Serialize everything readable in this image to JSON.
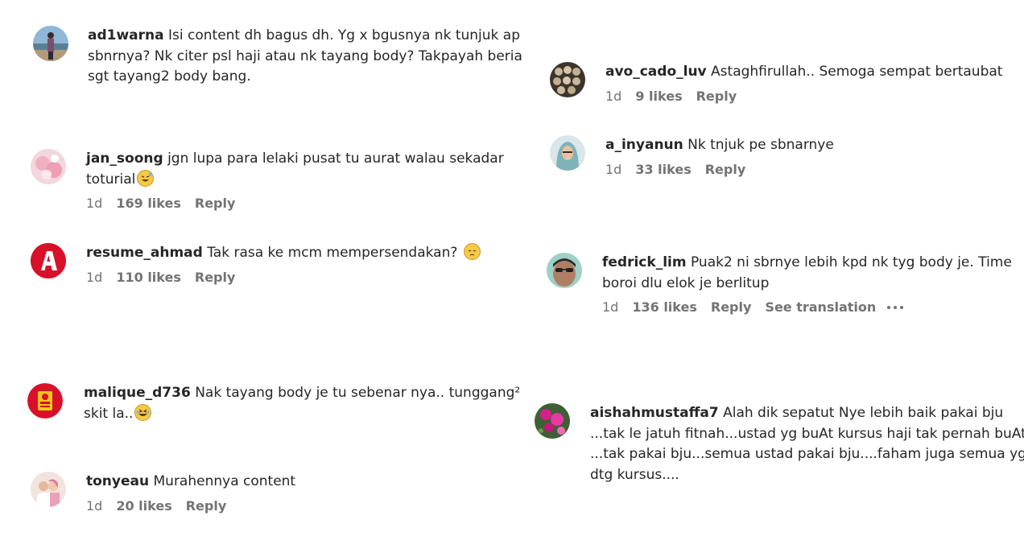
{
  "comments": [
    {
      "username": "ad1warna",
      "lines": [
        "Isi content dh bagus dh. Yg x bgusnya nk tunjuk ap",
        "sbnrnya? Nk citer psl haji atau nk tayang body? Takpayah beria",
        "sgt tayang2 body bang."
      ],
      "avatar": "avatar-person-seaside"
    },
    {
      "username": "jan_soong",
      "lines": [
        "jgn lupa para lelaki pusat tu aurat walau sekadar",
        "toturial"
      ],
      "emoji": "sweat-smile-emoji",
      "time": "1d",
      "likes": "169 likes",
      "reply": "Reply",
      "avatar": "avatar-pink-flowers"
    },
    {
      "username": "resume_ahmad",
      "lines": [
        "Tak rasa ke mcm mempersendakan?"
      ],
      "emoji": "pensive-emoji",
      "time": "1d",
      "likes": "110 likes",
      "reply": "Reply",
      "avatar": "avatar-red-letter-a"
    },
    {
      "username": "malique_d736",
      "lines": [
        "Nak tayang body je tu sebenar nya.. tunggang²",
        "skit la.."
      ],
      "emoji": "laughing-emoji",
      "avatar": "avatar-red-yellow-logo"
    },
    {
      "username": "tonyeau",
      "lines": [
        "Murahennya content"
      ],
      "time": "1d",
      "likes": "20 likes",
      "reply": "Reply",
      "avatar": "avatar-couple"
    },
    {
      "username": "avo_cado_luv",
      "lines": [
        "Astaghfirullah.. Semoga sempat bertaubat"
      ],
      "time": "1d",
      "likes": "9 likes",
      "reply": "Reply",
      "avatar": "avatar-balls"
    },
    {
      "username": "a_inyanun",
      "lines": [
        "Nk tnjuk pe sbnarnye"
      ],
      "time": "1d",
      "likes": "33 likes",
      "reply": "Reply",
      "avatar": "avatar-hijab-woman"
    },
    {
      "username": "fedrick_lim",
      "lines": [
        "Puak2 ni sbrnye lebih kpd nk tyg body je. Time",
        "boroi dlu elok je berlitup"
      ],
      "time": "1d",
      "likes": "136 likes",
      "reply": "Reply",
      "translation": "See translation",
      "avatar": "avatar-man-glasses"
    },
    {
      "username": "aishahmustaffa7",
      "lines": [
        "Alah dik sepatut Nye lebih baik pakai bju",
        "...tak le jatuh fitnah...ustad yg buAt kursus haji tak pernah buAt",
        "...tak pakai bju...semua ustad pakai bju....faham juga semua yg",
        "dtg kursus...."
      ],
      "avatar": "avatar-pink-bougainvillea"
    }
  ],
  "colors": {
    "text": "#262626",
    "meta": "#737373",
    "background": "#ffffff"
  }
}
